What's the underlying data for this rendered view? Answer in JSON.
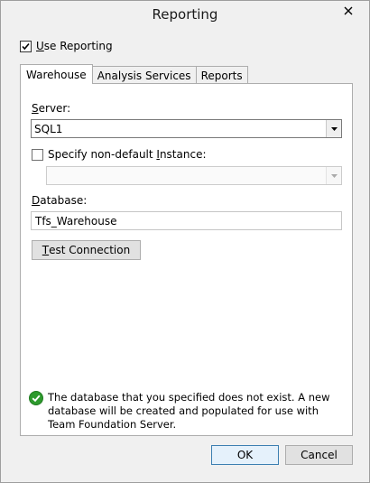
{
  "window": {
    "title": "Reporting",
    "close_glyph": "×"
  },
  "use_reporting": {
    "checked": true,
    "label_underline": "U",
    "label_rest": "se Reporting"
  },
  "tabs": [
    {
      "label": "Warehouse",
      "active": true
    },
    {
      "label": "Analysis Services",
      "active": false
    },
    {
      "label": "Reports",
      "active": false
    }
  ],
  "warehouse": {
    "server_label_underline": "S",
    "server_label_rest": "erver:",
    "server_value": "SQL1",
    "instance_checkbox_checked": false,
    "instance_label_pre": "Specify non-default ",
    "instance_label_underline": "I",
    "instance_label_rest": "nstance:",
    "instance_value": "",
    "database_label_underline": "D",
    "database_label_rest": "atabase:",
    "database_value": "Tfs_Warehouse",
    "test_button_underline": "T",
    "test_button_rest": "est Connection",
    "status_icon": "check-circle-icon",
    "status_color": "#2e9a2e",
    "status_message": "The database that you specified does not exist. A new database will be created and populated for use with Team Foundation Server."
  },
  "buttons": {
    "ok": "OK",
    "cancel": "Cancel"
  }
}
